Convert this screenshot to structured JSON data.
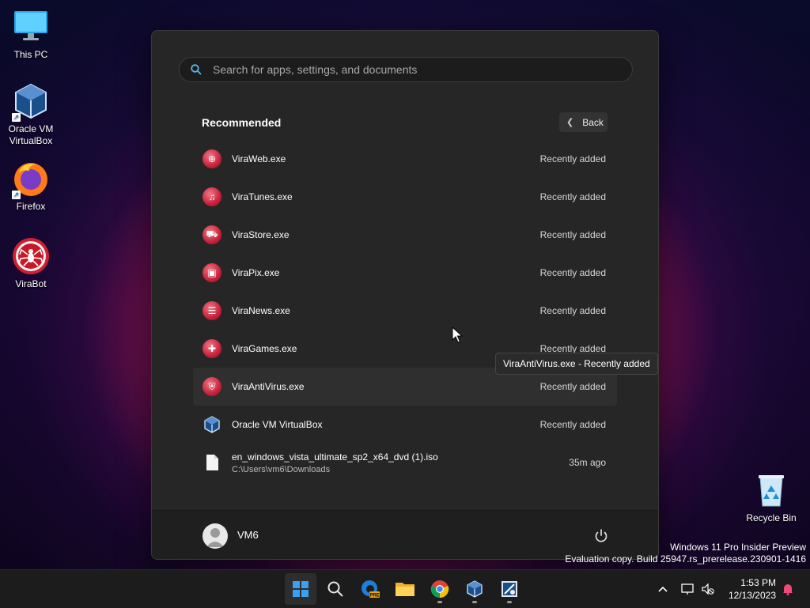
{
  "desktop": {
    "icons": [
      {
        "label": "This PC",
        "icon": "monitor-icon"
      },
      {
        "label": "Oracle VM VirtualBox",
        "icon": "virtualbox-icon"
      },
      {
        "label": "Firefox",
        "icon": "firefox-icon"
      },
      {
        "label": "ViraBot",
        "icon": "spider-icon"
      },
      {
        "label": "Recycle Bin",
        "icon": "recycle-bin-icon"
      }
    ]
  },
  "start_menu": {
    "search_placeholder": "Search for apps, settings, and documents",
    "recommended_title": "Recommended",
    "back_label": "Back",
    "items": [
      {
        "name": "ViraWeb.exe",
        "when": "Recently added",
        "icon": "globe-icon"
      },
      {
        "name": "ViraTunes.exe",
        "when": "Recently added",
        "icon": "music-note-icon"
      },
      {
        "name": "ViraStore.exe",
        "when": "Recently added",
        "icon": "cart-icon"
      },
      {
        "name": "ViraPix.exe",
        "when": "Recently added",
        "icon": "picture-icon"
      },
      {
        "name": "ViraNews.exe",
        "when": "Recently added",
        "icon": "newspaper-icon"
      },
      {
        "name": "ViraGames.exe",
        "when": "Recently added",
        "icon": "gamepad-icon"
      },
      {
        "name": "ViraAntiVirus.exe",
        "when": "Recently added",
        "icon": "shield-icon"
      },
      {
        "name": "Oracle VM VirtualBox",
        "when": "Recently added",
        "icon": "virtualbox-icon"
      },
      {
        "name": "en_windows_vista_ultimate_sp2_x64_dvd (1).iso",
        "path": "C:\\Users\\vm6\\Downloads",
        "when": "35m ago",
        "icon": "file-icon"
      }
    ],
    "tooltip": "ViraAntiVirus.exe - Recently added",
    "user_name": "VM6"
  },
  "watermark": {
    "line1": "Windows 11 Pro Insider Preview",
    "line2": "Evaluation copy. Build 25947.rs_prerelease.230901-1416"
  },
  "taskbar": {
    "apps": [
      "start-icon",
      "search-icon",
      "edge-beta-icon",
      "file-explorer-icon",
      "chrome-icon",
      "virtualbox-icon",
      "vista-iso-icon"
    ],
    "time": "1:53 PM",
    "date": "12/13/2023"
  }
}
